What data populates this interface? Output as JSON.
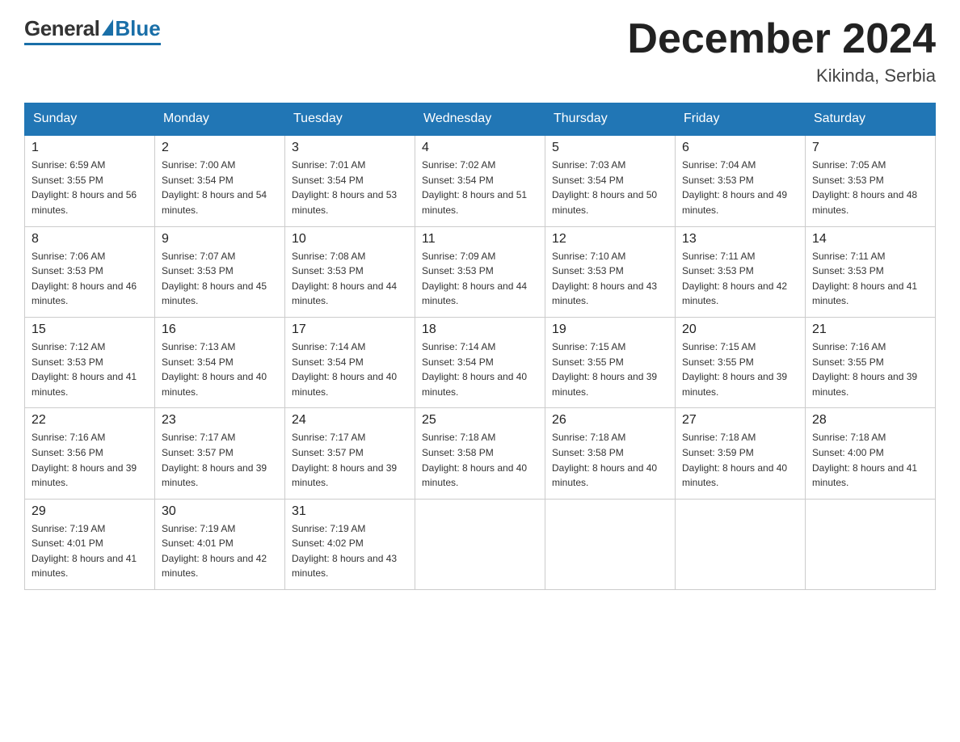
{
  "header": {
    "logo_general": "General",
    "logo_blue": "Blue",
    "month_title": "December 2024",
    "location": "Kikinda, Serbia"
  },
  "calendar": {
    "days_of_week": [
      "Sunday",
      "Monday",
      "Tuesday",
      "Wednesday",
      "Thursday",
      "Friday",
      "Saturday"
    ],
    "weeks": [
      [
        {
          "day": "1",
          "sunrise": "6:59 AM",
          "sunset": "3:55 PM",
          "daylight": "8 hours and 56 minutes."
        },
        {
          "day": "2",
          "sunrise": "7:00 AM",
          "sunset": "3:54 PM",
          "daylight": "8 hours and 54 minutes."
        },
        {
          "day": "3",
          "sunrise": "7:01 AM",
          "sunset": "3:54 PM",
          "daylight": "8 hours and 53 minutes."
        },
        {
          "day": "4",
          "sunrise": "7:02 AM",
          "sunset": "3:54 PM",
          "daylight": "8 hours and 51 minutes."
        },
        {
          "day": "5",
          "sunrise": "7:03 AM",
          "sunset": "3:54 PM",
          "daylight": "8 hours and 50 minutes."
        },
        {
          "day": "6",
          "sunrise": "7:04 AM",
          "sunset": "3:53 PM",
          "daylight": "8 hours and 49 minutes."
        },
        {
          "day": "7",
          "sunrise": "7:05 AM",
          "sunset": "3:53 PM",
          "daylight": "8 hours and 48 minutes."
        }
      ],
      [
        {
          "day": "8",
          "sunrise": "7:06 AM",
          "sunset": "3:53 PM",
          "daylight": "8 hours and 46 minutes."
        },
        {
          "day": "9",
          "sunrise": "7:07 AM",
          "sunset": "3:53 PM",
          "daylight": "8 hours and 45 minutes."
        },
        {
          "day": "10",
          "sunrise": "7:08 AM",
          "sunset": "3:53 PM",
          "daylight": "8 hours and 44 minutes."
        },
        {
          "day": "11",
          "sunrise": "7:09 AM",
          "sunset": "3:53 PM",
          "daylight": "8 hours and 44 minutes."
        },
        {
          "day": "12",
          "sunrise": "7:10 AM",
          "sunset": "3:53 PM",
          "daylight": "8 hours and 43 minutes."
        },
        {
          "day": "13",
          "sunrise": "7:11 AM",
          "sunset": "3:53 PM",
          "daylight": "8 hours and 42 minutes."
        },
        {
          "day": "14",
          "sunrise": "7:11 AM",
          "sunset": "3:53 PM",
          "daylight": "8 hours and 41 minutes."
        }
      ],
      [
        {
          "day": "15",
          "sunrise": "7:12 AM",
          "sunset": "3:53 PM",
          "daylight": "8 hours and 41 minutes."
        },
        {
          "day": "16",
          "sunrise": "7:13 AM",
          "sunset": "3:54 PM",
          "daylight": "8 hours and 40 minutes."
        },
        {
          "day": "17",
          "sunrise": "7:14 AM",
          "sunset": "3:54 PM",
          "daylight": "8 hours and 40 minutes."
        },
        {
          "day": "18",
          "sunrise": "7:14 AM",
          "sunset": "3:54 PM",
          "daylight": "8 hours and 40 minutes."
        },
        {
          "day": "19",
          "sunrise": "7:15 AM",
          "sunset": "3:55 PM",
          "daylight": "8 hours and 39 minutes."
        },
        {
          "day": "20",
          "sunrise": "7:15 AM",
          "sunset": "3:55 PM",
          "daylight": "8 hours and 39 minutes."
        },
        {
          "day": "21",
          "sunrise": "7:16 AM",
          "sunset": "3:55 PM",
          "daylight": "8 hours and 39 minutes."
        }
      ],
      [
        {
          "day": "22",
          "sunrise": "7:16 AM",
          "sunset": "3:56 PM",
          "daylight": "8 hours and 39 minutes."
        },
        {
          "day": "23",
          "sunrise": "7:17 AM",
          "sunset": "3:57 PM",
          "daylight": "8 hours and 39 minutes."
        },
        {
          "day": "24",
          "sunrise": "7:17 AM",
          "sunset": "3:57 PM",
          "daylight": "8 hours and 39 minutes."
        },
        {
          "day": "25",
          "sunrise": "7:18 AM",
          "sunset": "3:58 PM",
          "daylight": "8 hours and 40 minutes."
        },
        {
          "day": "26",
          "sunrise": "7:18 AM",
          "sunset": "3:58 PM",
          "daylight": "8 hours and 40 minutes."
        },
        {
          "day": "27",
          "sunrise": "7:18 AM",
          "sunset": "3:59 PM",
          "daylight": "8 hours and 40 minutes."
        },
        {
          "day": "28",
          "sunrise": "7:18 AM",
          "sunset": "4:00 PM",
          "daylight": "8 hours and 41 minutes."
        }
      ],
      [
        {
          "day": "29",
          "sunrise": "7:19 AM",
          "sunset": "4:01 PM",
          "daylight": "8 hours and 41 minutes."
        },
        {
          "day": "30",
          "sunrise": "7:19 AM",
          "sunset": "4:01 PM",
          "daylight": "8 hours and 42 minutes."
        },
        {
          "day": "31",
          "sunrise": "7:19 AM",
          "sunset": "4:02 PM",
          "daylight": "8 hours and 43 minutes."
        },
        null,
        null,
        null,
        null
      ]
    ]
  }
}
